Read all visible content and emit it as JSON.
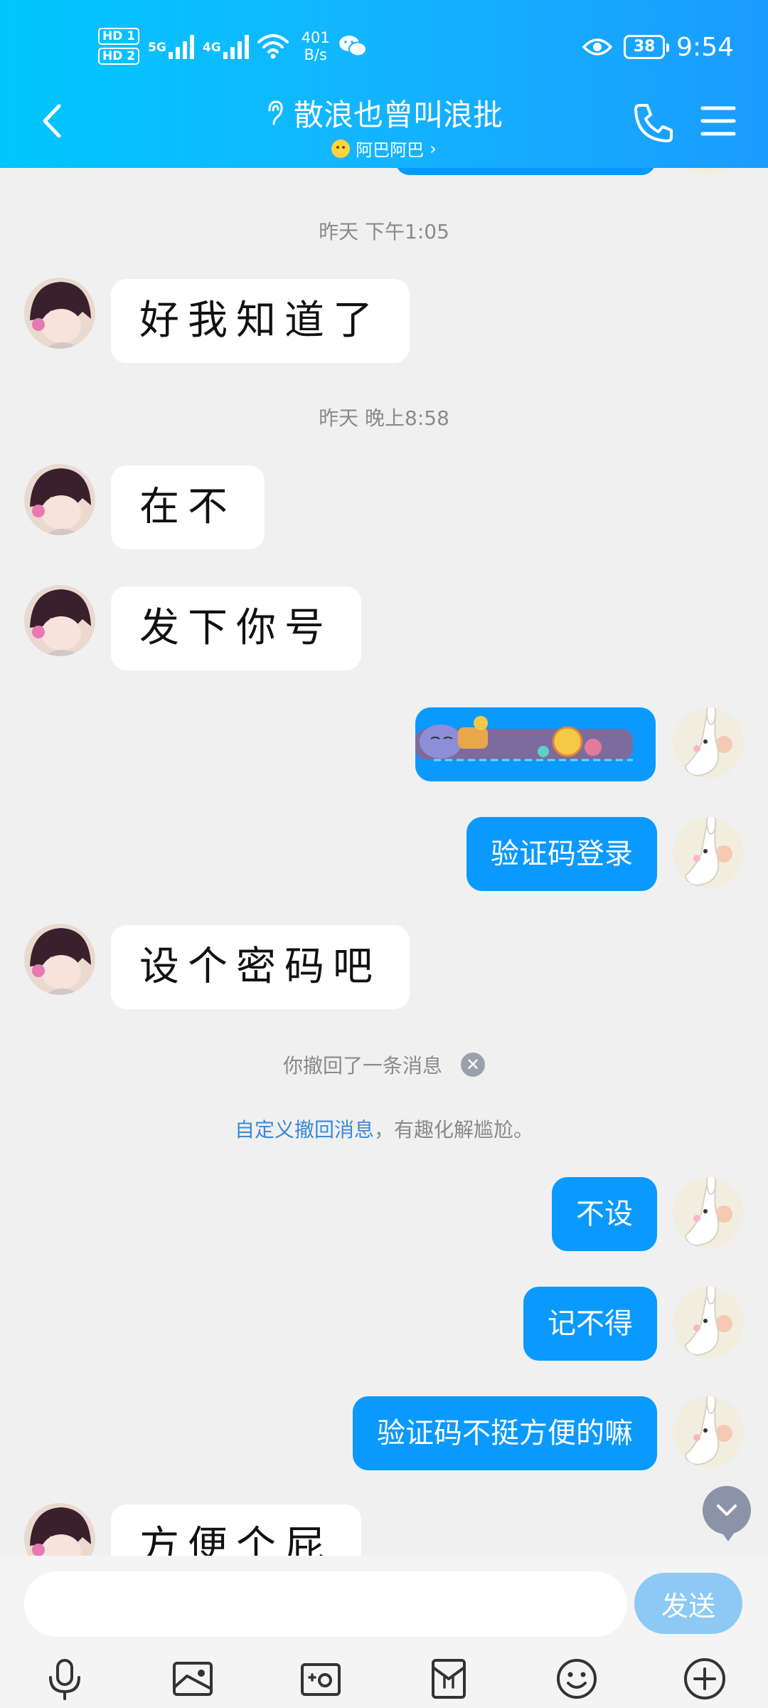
{
  "status_bar": {
    "hd1": "HD 1",
    "hd2": "HD 2",
    "net1": "5G",
    "net2": "4G",
    "speed_value": "401",
    "speed_unit": "B/s",
    "battery": "38",
    "time": "9:54"
  },
  "header": {
    "title": "散浪也曾叫浪批",
    "subtitle": "阿巴阿巴",
    "subtitle_chevron": "›"
  },
  "chat": {
    "time1": "昨天 下午1:05",
    "time2": "昨天 晚上8:58",
    "msg1": "好我知道了",
    "msg2": "在不",
    "msg3": "发下你号",
    "out1": "验证码登录",
    "msg4": "设个密码吧",
    "recall_notice": "你撤回了一条消息",
    "custom_link": "自定义撤回消息",
    "custom_rest": "，有趣化解尴尬。",
    "out2": "不设",
    "out3": "记不得",
    "out4": "验证码不挺方便的嘛",
    "msg5": "方便个屁"
  },
  "input": {
    "value": "",
    "send_label": "发送"
  },
  "icons": [
    "microphone-icon",
    "image-icon",
    "camera-icon",
    "red-packet-icon",
    "emoji-icon",
    "plus-icon"
  ]
}
